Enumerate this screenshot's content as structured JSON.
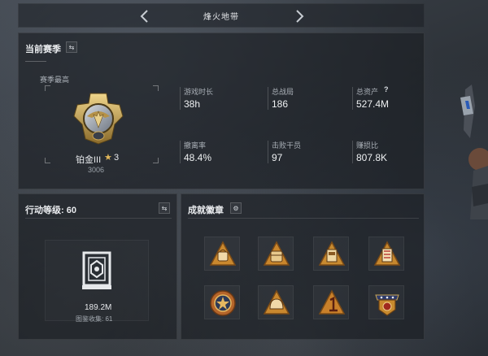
{
  "nav": {
    "title": "烽火地带"
  },
  "season": {
    "title": "当前赛季",
    "best_label": "赛季最高",
    "rank_name": "铂金III",
    "rank_stars": "3",
    "rank_points": "3006",
    "stats": [
      {
        "label": "游戏时长",
        "value": "38h"
      },
      {
        "label": "总战局",
        "value": "186"
      },
      {
        "label": "总资产",
        "value": "527.4M"
      },
      {
        "label": "撤离率",
        "value": "48.4%"
      },
      {
        "label": "击败干员",
        "value": "97"
      },
      {
        "label": "赚损比",
        "value": "807.8K"
      }
    ],
    "help_icon": "?"
  },
  "action": {
    "title": "行动等级: 60",
    "value": "189.2M",
    "collect_label": "图鉴收集: 61"
  },
  "achievements": {
    "title": "成就徽章",
    "badges": [
      "bag-badge",
      "backpack-badge",
      "locker-badge",
      "door-badge",
      "medal-badge",
      "helmet-badge",
      "number-one-badge",
      "stars-emblem-badge"
    ]
  },
  "colors": {
    "gold": "#c8a14e",
    "accent": "#e2b85a"
  }
}
